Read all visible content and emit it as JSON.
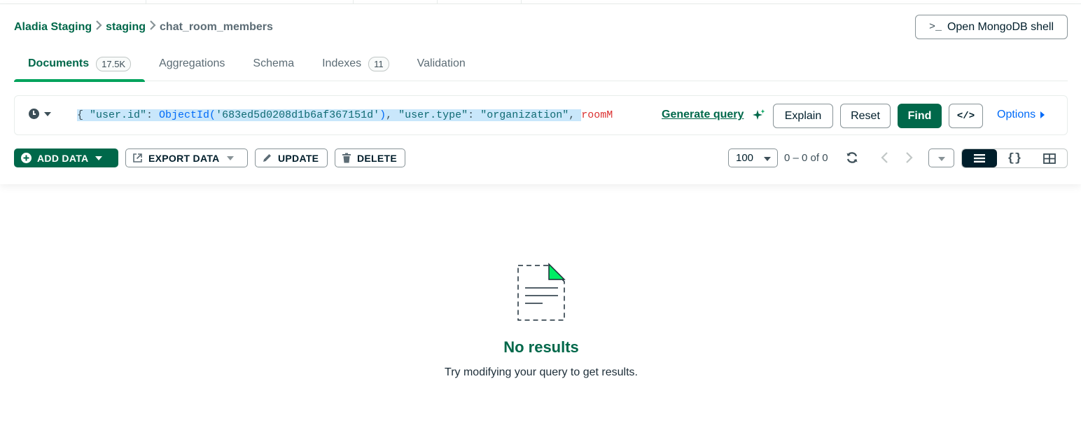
{
  "breadcrumb": {
    "cluster": "Aladia Staging",
    "database": "staging",
    "collection": "chat_room_members"
  },
  "shell_button": {
    "prompt": ">_",
    "label": "Open MongoDB shell"
  },
  "tabs": [
    {
      "label": "Documents",
      "count": "17.5K",
      "active": true
    },
    {
      "label": "Aggregations"
    },
    {
      "label": "Schema"
    },
    {
      "label": "Indexes",
      "count": "11"
    },
    {
      "label": "Validation"
    }
  ],
  "query": {
    "open_brace": "{ ",
    "key1": "\"user.id\"",
    "colon1": ": ",
    "fn": "ObjectId(",
    "id_value": "'683ed5d0208d1b6af367151d'",
    "fn_close": ")",
    "comma1": ", ",
    "key2": "\"user.type\"",
    "colon2": ": ",
    "val2": "\"organization\"",
    "comma2": ", ",
    "key3_partial": "roomM"
  },
  "query_actions": {
    "generate_query": "Generate query",
    "explain": "Explain",
    "reset": "Reset",
    "find": "Find",
    "code_icon": "</>",
    "options": "Options"
  },
  "toolbar": {
    "add_data": "ADD DATA",
    "export_data": "EXPORT DATA",
    "update": "UPDATE",
    "delete": "DELETE",
    "page_size": "100",
    "range": "0 – 0 of 0"
  },
  "empty_state": {
    "title": "No results",
    "subtitle": "Try modifying your query to get results."
  },
  "colors": {
    "brand_green": "#00684a",
    "accent_green": "#00a35c",
    "link_blue": "#016bf8",
    "dark": "#001e2b"
  }
}
